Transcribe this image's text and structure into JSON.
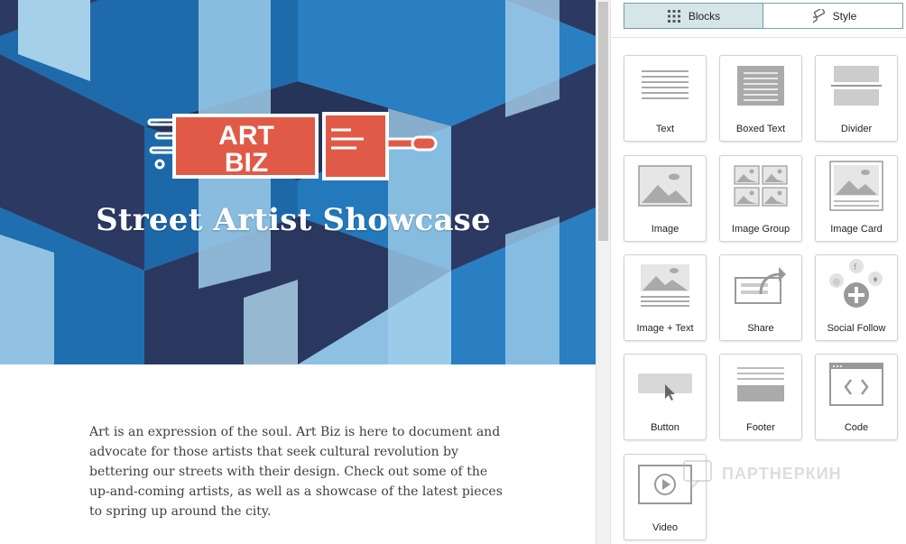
{
  "hero": {
    "logo_line1": "ART",
    "logo_line2": "BIZ",
    "title": "Street Artist Showcase"
  },
  "body_text": "Art is an expression of the soul. Art Biz is here to document and advocate for those artists that seek cultural revolution by bettering our streets with their design. Check out some of the up-and-coming artists, as well as a showcase of the latest pieces to spring up around the city.",
  "panel": {
    "tabs": [
      {
        "label": "Blocks",
        "icon": "grid-icon",
        "active": true
      },
      {
        "label": "Style",
        "icon": "paint-roller-icon",
        "active": false
      }
    ],
    "blocks": [
      {
        "label": "Text",
        "icon": "text-icon"
      },
      {
        "label": "Boxed Text",
        "icon": "boxed-text-icon"
      },
      {
        "label": "Divider",
        "icon": "divider-icon"
      },
      {
        "label": "Image",
        "icon": "image-icon"
      },
      {
        "label": "Image Group",
        "icon": "image-group-icon"
      },
      {
        "label": "Image Card",
        "icon": "image-card-icon"
      },
      {
        "label": "Image + Text",
        "icon": "image-text-icon"
      },
      {
        "label": "Share",
        "icon": "share-icon"
      },
      {
        "label": "Social Follow",
        "icon": "social-follow-icon"
      },
      {
        "label": "Button",
        "icon": "button-icon"
      },
      {
        "label": "Footer",
        "icon": "footer-icon"
      },
      {
        "label": "Code",
        "icon": "code-icon"
      },
      {
        "label": "Video",
        "icon": "video-icon"
      }
    ]
  },
  "watermark": "ПАРТНЕРКИН",
  "colors": {
    "logo_red": "#e05a47",
    "tab_active_bg": "#d6e6e8",
    "tab_border": "#7aa3a6"
  }
}
